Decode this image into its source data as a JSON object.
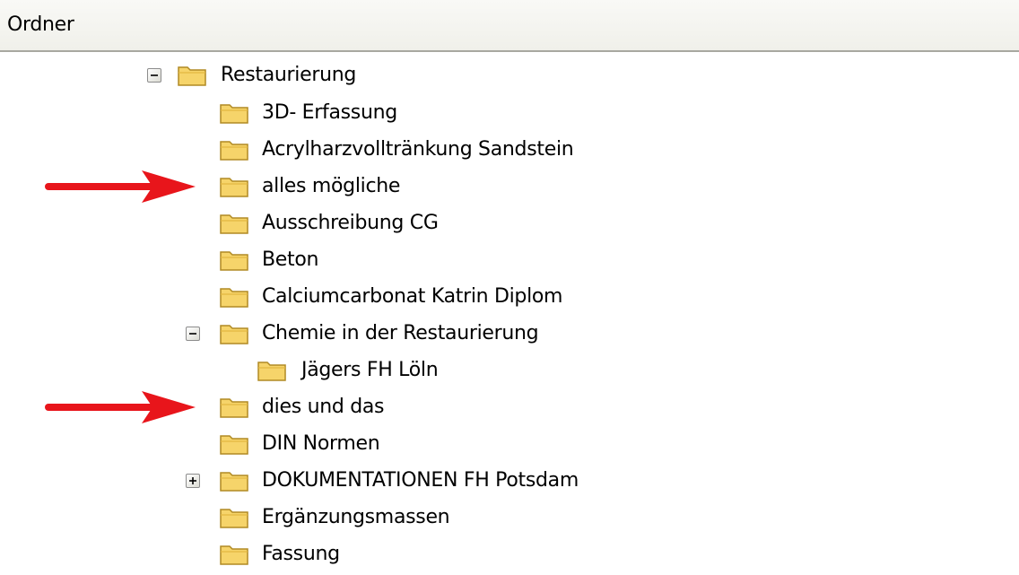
{
  "header": {
    "title": "Ordner"
  },
  "tree": {
    "root": {
      "label": "Restaurierung",
      "expander": "minus"
    },
    "items": [
      {
        "label": "3D- Erfassung"
      },
      {
        "label": "Acrylharzvolltränkung Sandstein"
      },
      {
        "label": "alles mögliche",
        "highlighted": true
      },
      {
        "label": "Ausschreibung CG"
      },
      {
        "label": "Beton"
      },
      {
        "label": "Calciumcarbonat Katrin Diplom"
      },
      {
        "label": "Chemie in der Restaurierung",
        "expander": "minus"
      },
      {
        "label": "Jägers FH Löln"
      },
      {
        "label": "dies und das",
        "highlighted": true
      },
      {
        "label": "DIN Normen"
      },
      {
        "label": "DOKUMENTATIONEN FH Potsdam",
        "expander": "plus"
      },
      {
        "label": "Ergänzungsmassen"
      },
      {
        "label": "Fassung"
      }
    ]
  },
  "icons": {
    "folder": "folder-icon",
    "collapse": "minus-box-icon",
    "expand": "plus-box-icon",
    "pointer": "red-arrow"
  },
  "colors": {
    "folder_fill": "#f6d46a",
    "folder_stroke": "#b08a24",
    "arrow": "#e8151b"
  }
}
